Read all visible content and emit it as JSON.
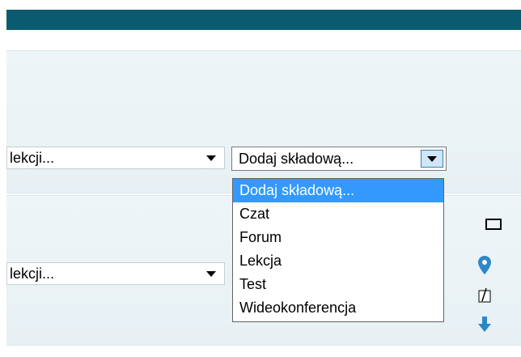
{
  "section1": {
    "lesson_select": {
      "value": "lekcji..."
    },
    "add_component_select": {
      "value": "Dodaj składową..."
    }
  },
  "dropdown": {
    "options": [
      {
        "label": "Dodaj składową...",
        "selected": true
      },
      {
        "label": "Czat"
      },
      {
        "label": "Forum"
      },
      {
        "label": "Lekcja"
      },
      {
        "label": "Test"
      },
      {
        "label": "Wideokonferencja"
      }
    ]
  },
  "section2": {
    "lesson_select": {
      "value": "lekcji..."
    }
  },
  "icons": [
    "square-icon",
    "location-pin-icon",
    "edit-icon",
    "download-arrow-icon"
  ],
  "colors": {
    "topbar": "#0a5b70",
    "section_bg": "#eef5f8",
    "selected_option": "#3399ff",
    "icon_blue": "#2c87c9"
  }
}
